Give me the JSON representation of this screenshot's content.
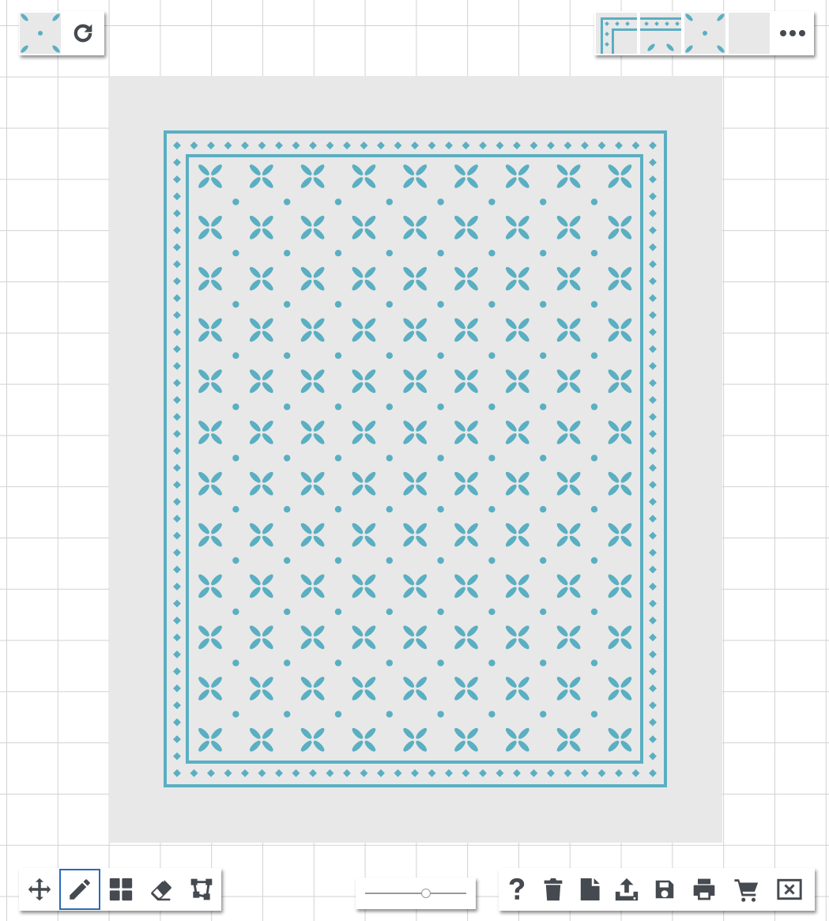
{
  "colors": {
    "accent": "#5aafc2",
    "icon": "#454a50",
    "canvas": "#e8e8e8",
    "active_outline": "#2a6ab8"
  },
  "top_left_toolbar": {
    "tools": [
      {
        "name": "current-tile-swatch",
        "icon": "tile-pattern-icon",
        "active": false
      },
      {
        "name": "rotate-button",
        "icon": "rotate-icon",
        "active": false
      }
    ]
  },
  "top_right_toolbar": {
    "swatches": [
      {
        "name": "border-corner-tile",
        "icon": "border-corner-icon"
      },
      {
        "name": "border-edge-tile",
        "icon": "border-edge-icon"
      },
      {
        "name": "dot-petal-tile",
        "icon": "tile-pattern-icon"
      },
      {
        "name": "blank-tile",
        "icon": "blank-tile-icon"
      }
    ],
    "more": {
      "icon": "more-icon"
    }
  },
  "bottom_left_toolbar": {
    "tools": [
      {
        "name": "move-tool",
        "icon": "move-icon",
        "active": false
      },
      {
        "name": "pencil-tool",
        "icon": "pencil-icon",
        "active": true
      },
      {
        "name": "fill-tool",
        "icon": "grid-icon",
        "active": false
      },
      {
        "name": "eraser-tool",
        "icon": "eraser-icon",
        "active": false
      },
      {
        "name": "resize-tool",
        "icon": "resize-icon",
        "active": false
      }
    ]
  },
  "zoom": {
    "level": 0.6
  },
  "bottom_right_toolbar": {
    "tools": [
      {
        "name": "help-button",
        "icon": "help-icon"
      },
      {
        "name": "delete-button",
        "icon": "trash-icon"
      },
      {
        "name": "new-button",
        "icon": "new-file-icon"
      },
      {
        "name": "export-button",
        "icon": "upload-icon"
      },
      {
        "name": "save-button",
        "icon": "save-icon"
      },
      {
        "name": "print-button",
        "icon": "print-icon"
      },
      {
        "name": "cart-button",
        "icon": "cart-icon"
      },
      {
        "name": "close-button",
        "icon": "close-icon"
      }
    ]
  },
  "rug": {
    "columns": 9,
    "rows": 12,
    "border_diamonds": true
  }
}
